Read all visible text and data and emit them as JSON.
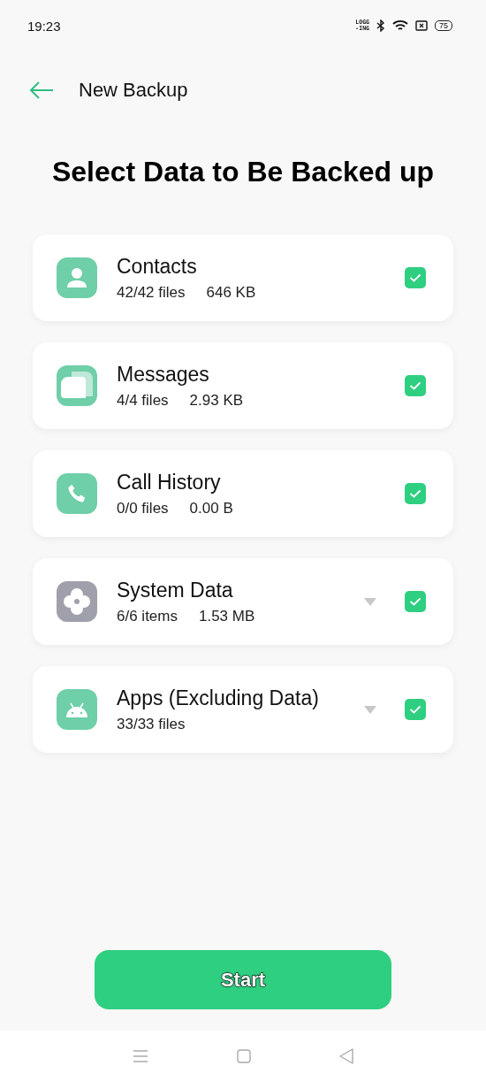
{
  "status_bar": {
    "time": "19:23",
    "logging_badge": [
      "LOGG",
      "-ING"
    ],
    "battery": "75"
  },
  "header": {
    "title": "New Backup"
  },
  "heading": "Select Data to Be Backed up",
  "items": [
    {
      "title": "Contacts",
      "count": "42/42 files",
      "size": "646 KB",
      "expandable": false,
      "checked": true
    },
    {
      "title": "Messages",
      "count": "4/4 files",
      "size": "2.93 KB",
      "expandable": false,
      "checked": true
    },
    {
      "title": "Call History",
      "count": "0/0 files",
      "size": "0.00 B",
      "expandable": false,
      "checked": true
    },
    {
      "title": "System Data",
      "count": "6/6 items",
      "size": "1.53 MB",
      "expandable": true,
      "checked": true
    },
    {
      "title": "Apps (Excluding Data)",
      "count": "33/33 files",
      "expandable": true,
      "checked": true
    }
  ],
  "start_button": "Start"
}
